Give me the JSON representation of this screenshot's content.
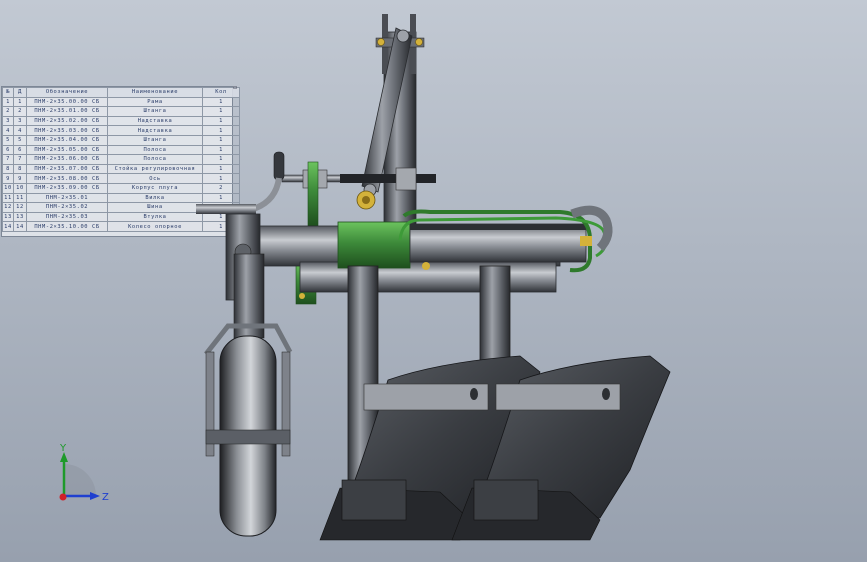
{
  "bom": {
    "corner_mark": "▫",
    "headers": [
      "№",
      "Д",
      "Обозначение",
      "Наименование",
      "Кол"
    ],
    "rows": [
      [
        "1",
        "1",
        "ПНМ-2×35.00.00 СБ",
        "Рама",
        "1"
      ],
      [
        "2",
        "2",
        "ПНМ-2×35.01.00 СБ",
        "Штанга",
        "1"
      ],
      [
        "3",
        "3",
        "ПНМ-2×35.02.00 СБ",
        "Надставка",
        "1"
      ],
      [
        "4",
        "4",
        "ПНМ-2×35.03.00 СБ",
        "Надставка",
        "1"
      ],
      [
        "5",
        "5",
        "ПНМ-2×35.04.00 СБ",
        "Штанга",
        "1"
      ],
      [
        "6",
        "6",
        "ПНМ-2×35.05.00 СБ",
        "Полоса",
        "1"
      ],
      [
        "7",
        "7",
        "ПНМ-2×35.06.00 СБ",
        "Полоса",
        "1"
      ],
      [
        "8",
        "8",
        "ПНМ-2×35.07.00 СБ",
        "Стойка регулировочная",
        "1"
      ],
      [
        "9",
        "9",
        "ПНМ-2×35.08.00 СБ",
        "Ось",
        "1"
      ],
      [
        "10",
        "10",
        "ПНМ-2×35.09.00 СБ",
        "Корпус плуга",
        "2"
      ],
      [
        "11",
        "11",
        "ПНМ-2×35.01",
        "Вилка",
        "1"
      ],
      [
        "12",
        "12",
        "ПНМ-2×35.02",
        "Шина",
        "1"
      ],
      [
        "13",
        "13",
        "ПНМ-2×35.03",
        "Втулка",
        "1"
      ],
      [
        "14",
        "14",
        "ПНМ-2×35.10.00 СБ",
        "Колесо опорное",
        "1"
      ]
    ]
  },
  "triad": {
    "y_label": "Y",
    "z_label": "Z"
  },
  "colors": {
    "steel_dark": "#3a3d42",
    "steel_mid": "#6f747b",
    "steel_light": "#b4b8be",
    "green": "#3d8a3a",
    "green_dark": "#215a20",
    "axis_y": "#1e9a2a",
    "axis_z": "#1f3fd0",
    "origin": "#d0202a"
  }
}
